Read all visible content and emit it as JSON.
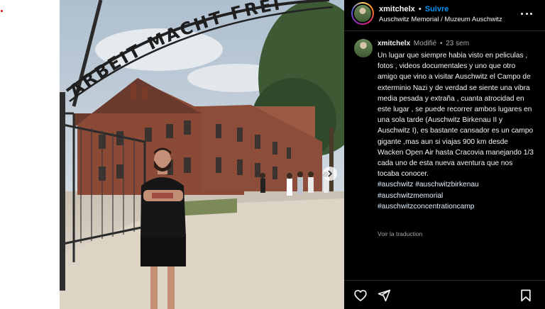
{
  "header": {
    "username": "xmitchelx",
    "separator": "•",
    "follow_label": "Suivre",
    "location": "Auschwitz Memorial / Muzeum Auschwitz"
  },
  "photo": {
    "gate_sign": "ARBEIT MACHT FREI"
  },
  "caption": {
    "username": "xmitchelx",
    "edited": "Modifié",
    "separator": "•",
    "age": "23 sem",
    "text": "Un lugar que siempre habia visto en peliculas , fotos , videos documentales y uno que otro amigo que vino a visitar Auschwitz el Campo de exterminio Nazi y de verdad se siente una vibra media pesada y extraña , cuanta atrocidad en este lugar , se puede recorrer ambos lugares en una sola tarde (Auschwitz Birkenau II y Auschwitz I), es bastante cansador es un campo gigante ,mas aun si viajas 900 km desde Wacken Open Air hasta Cracovia manejando 1/3 cada uno de esta nueva aventura que nos tocaba conocer.",
    "hashtags": [
      "#auschwitz #auschwitzbirkenau",
      "#auschwitzmemorial",
      "#auschwitzconcentrationcamp"
    ],
    "translate_label": "Voir la traduction"
  },
  "icons": {
    "more": "more-options-icon",
    "next": "chevron-right-icon",
    "like": "heart-icon",
    "share": "send-icon",
    "save": "bookmark-icon"
  },
  "colors": {
    "panel_bg": "#000000",
    "follow": "#0095f6",
    "hashtag": "#e0f1ff",
    "muted": "#a8a8a8"
  }
}
